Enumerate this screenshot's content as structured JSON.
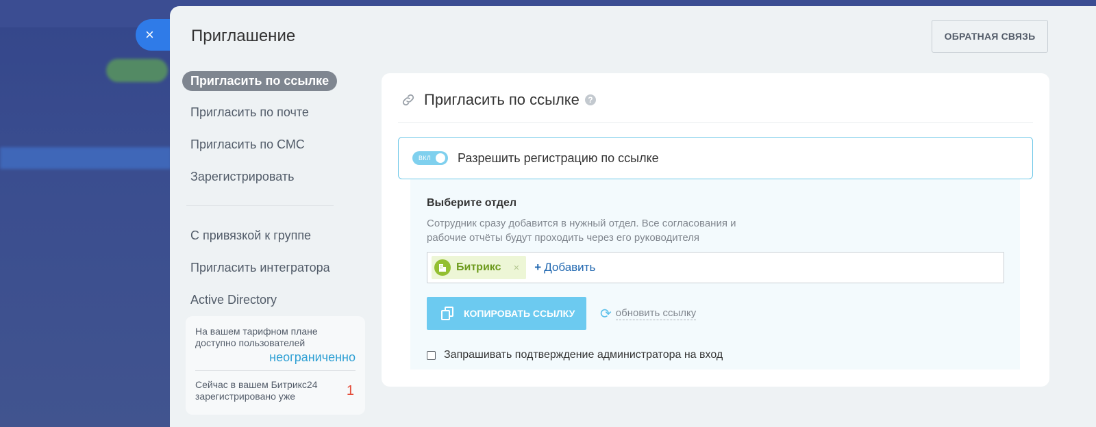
{
  "window": {
    "title": "Приглашение"
  },
  "header": {
    "feedback_label": "ОБРАТНАЯ СВЯЗЬ"
  },
  "nav": {
    "primary": [
      {
        "label": "Пригласить по ссылке",
        "active": true
      },
      {
        "label": "Пригласить по почте",
        "active": false
      },
      {
        "label": "Пригласить по СМС",
        "active": false
      },
      {
        "label": "Зарегистрировать",
        "active": false
      }
    ],
    "secondary": [
      {
        "label": "С привязкой к группе"
      },
      {
        "label": "Пригласить интегратора"
      },
      {
        "label": "Active Directory"
      }
    ]
  },
  "plan": {
    "available_text": "На вашем тарифном плане доступно пользователей",
    "available_value": "неограниченно",
    "registered_text": "Сейчас в вашем Битрикс24 зарегистрировано уже",
    "registered_value": "1"
  },
  "card": {
    "title": "Пригласить по ссылке",
    "help_icon": "?",
    "toggle": {
      "state_label": "ВКЛ",
      "label": "Разрешить регистрацию по ссылке",
      "on": true
    },
    "department": {
      "title": "Выберите отдел",
      "description": "Сотрудник сразу добавится в нужный отдел. Все согласования и рабочие отчёты будут проходить через его руководителя",
      "selected_tag": "Битрикс",
      "tag_remove": "×",
      "add_label": "Добавить",
      "add_plus": "+"
    },
    "copy_button": "КОПИРОВАТЬ ССЫЛКУ",
    "refresh_label": "обновить ссылку",
    "refresh_icon": "⟳",
    "confirm_label": "Запрашивать подтверждение администратора на вход"
  },
  "close_icon": "×",
  "colors": {
    "accent": "#2f7be8",
    "toggle": "#7fd0ee",
    "copy": "#6ccaf0",
    "tag_green": "#93bf32",
    "count_red": "#e44d3a",
    "value_blue": "#2fa0d4"
  }
}
